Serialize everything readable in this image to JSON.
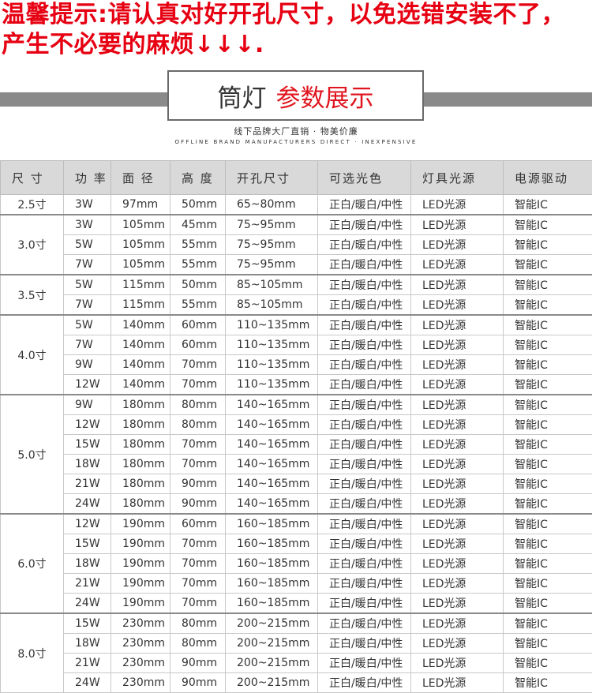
{
  "notice": {
    "line1": "温馨提示:请认真对好开孔尺寸，以免选错安装不了，",
    "line2": "产生不必要的麻烦↓↓↓."
  },
  "banner": {
    "title_black": "筒灯",
    "title_red": "参数展示",
    "subtitle_cn": "线下品牌大厂直销 · 物美价廉",
    "subtitle_en": "OFFLINE BRAND MANUFACTURERS DIRECT · INEXPENSIVE"
  },
  "colors": {
    "accent_red": "#e60012",
    "band_gray": "#8a8a8a",
    "header_gray": "#d9d9d9"
  },
  "table": {
    "headers": [
      "尺 寸",
      "功 率",
      "面 径",
      "高 度",
      "开孔尺寸",
      "可选光色",
      "灯具光源",
      "电源驱动"
    ],
    "groups": [
      {
        "size": "2.5寸",
        "rows": [
          [
            "3W",
            "97mm",
            "50mm",
            "65~80mm",
            "正白/暖白/中性",
            "LED光源",
            "智能IC"
          ]
        ]
      },
      {
        "size": "3.0寸",
        "rows": [
          [
            "3W",
            "105mm",
            "45mm",
            "75~95mm",
            "正白/暖白/中性",
            "LED光源",
            "智能IC"
          ],
          [
            "5W",
            "105mm",
            "55mm",
            "75~95mm",
            "正白/暖白/中性",
            "LED光源",
            "智能IC"
          ],
          [
            "7W",
            "105mm",
            "55mm",
            "75~95mm",
            "正白/暖白/中性",
            "LED光源",
            "智能IC"
          ]
        ]
      },
      {
        "size": "3.5寸",
        "rows": [
          [
            "5W",
            "115mm",
            "50mm",
            "85~105mm",
            "正白/暖白/中性",
            "LED光源",
            "智能IC"
          ],
          [
            "7W",
            "115mm",
            "55mm",
            "85~105mm",
            "正白/暖白/中性",
            "LED光源",
            "智能IC"
          ]
        ]
      },
      {
        "size": "4.0寸",
        "rows": [
          [
            "5W",
            "140mm",
            "60mm",
            "110~135mm",
            "正白/暖白/中性",
            "LED光源",
            "智能IC"
          ],
          [
            "7W",
            "140mm",
            "60mm",
            "110~135mm",
            "正白/暖白/中性",
            "LED光源",
            "智能IC"
          ],
          [
            "9W",
            "140mm",
            "70mm",
            "110~135mm",
            "正白/暖白/中性",
            "LED光源",
            "智能IC"
          ],
          [
            "12W",
            "140mm",
            "70mm",
            "110~135mm",
            "正白/暖白/中性",
            "LED光源",
            "智能IC"
          ]
        ]
      },
      {
        "size": "5.0寸",
        "rows": [
          [
            "9W",
            "180mm",
            "80mm",
            "140~165mm",
            "正白/暖白/中性",
            "LED光源",
            "智能IC"
          ],
          [
            "12W",
            "180mm",
            "80mm",
            "140~165mm",
            "正白/暖白/中性",
            "LED光源",
            "智能IC"
          ],
          [
            "15W",
            "180mm",
            "70mm",
            "140~165mm",
            "正白/暖白/中性",
            "LED光源",
            "智能IC"
          ],
          [
            "18W",
            "180mm",
            "70mm",
            "140~165mm",
            "正白/暖白/中性",
            "LED光源",
            "智能IC"
          ],
          [
            "21W",
            "180mm",
            "90mm",
            "140~165mm",
            "正白/暖白/中性",
            "LED光源",
            "智能IC"
          ],
          [
            "24W",
            "180mm",
            "90mm",
            "140~165mm",
            "正白/暖白/中性",
            "LED光源",
            "智能IC"
          ]
        ]
      },
      {
        "size": "6.0寸",
        "rows": [
          [
            "12W",
            "190mm",
            "60mm",
            "160~185mm",
            "正白/暖白/中性",
            "LED光源",
            "智能IC"
          ],
          [
            "15W",
            "190mm",
            "70mm",
            "160~185mm",
            "正白/暖白/中性",
            "LED光源",
            "智能IC"
          ],
          [
            "18W",
            "190mm",
            "70mm",
            "160~185mm",
            "正白/暖白/中性",
            "LED光源",
            "智能IC"
          ],
          [
            "21W",
            "190mm",
            "70mm",
            "160~185mm",
            "正白/暖白/中性",
            "LED光源",
            "智能IC"
          ],
          [
            "24W",
            "190mm",
            "70mm",
            "160~185mm",
            "正白/暖白/中性",
            "LED光源",
            "智能IC"
          ]
        ]
      },
      {
        "size": "8.0寸",
        "rows": [
          [
            "15W",
            "230mm",
            "80mm",
            "200~215mm",
            "正白/暖白/中性",
            "LED光源",
            "智能IC"
          ],
          [
            "18W",
            "230mm",
            "80mm",
            "200~215mm",
            "正白/暖白/中性",
            "LED光源",
            "智能IC"
          ],
          [
            "21W",
            "230mm",
            "90mm",
            "200~215mm",
            "正白/暖白/中性",
            "LED光源",
            "智能IC"
          ],
          [
            "24W",
            "230mm",
            "90mm",
            "200~215mm",
            "正白/暖白/中性",
            "LED光源",
            "智能IC"
          ]
        ]
      }
    ]
  }
}
